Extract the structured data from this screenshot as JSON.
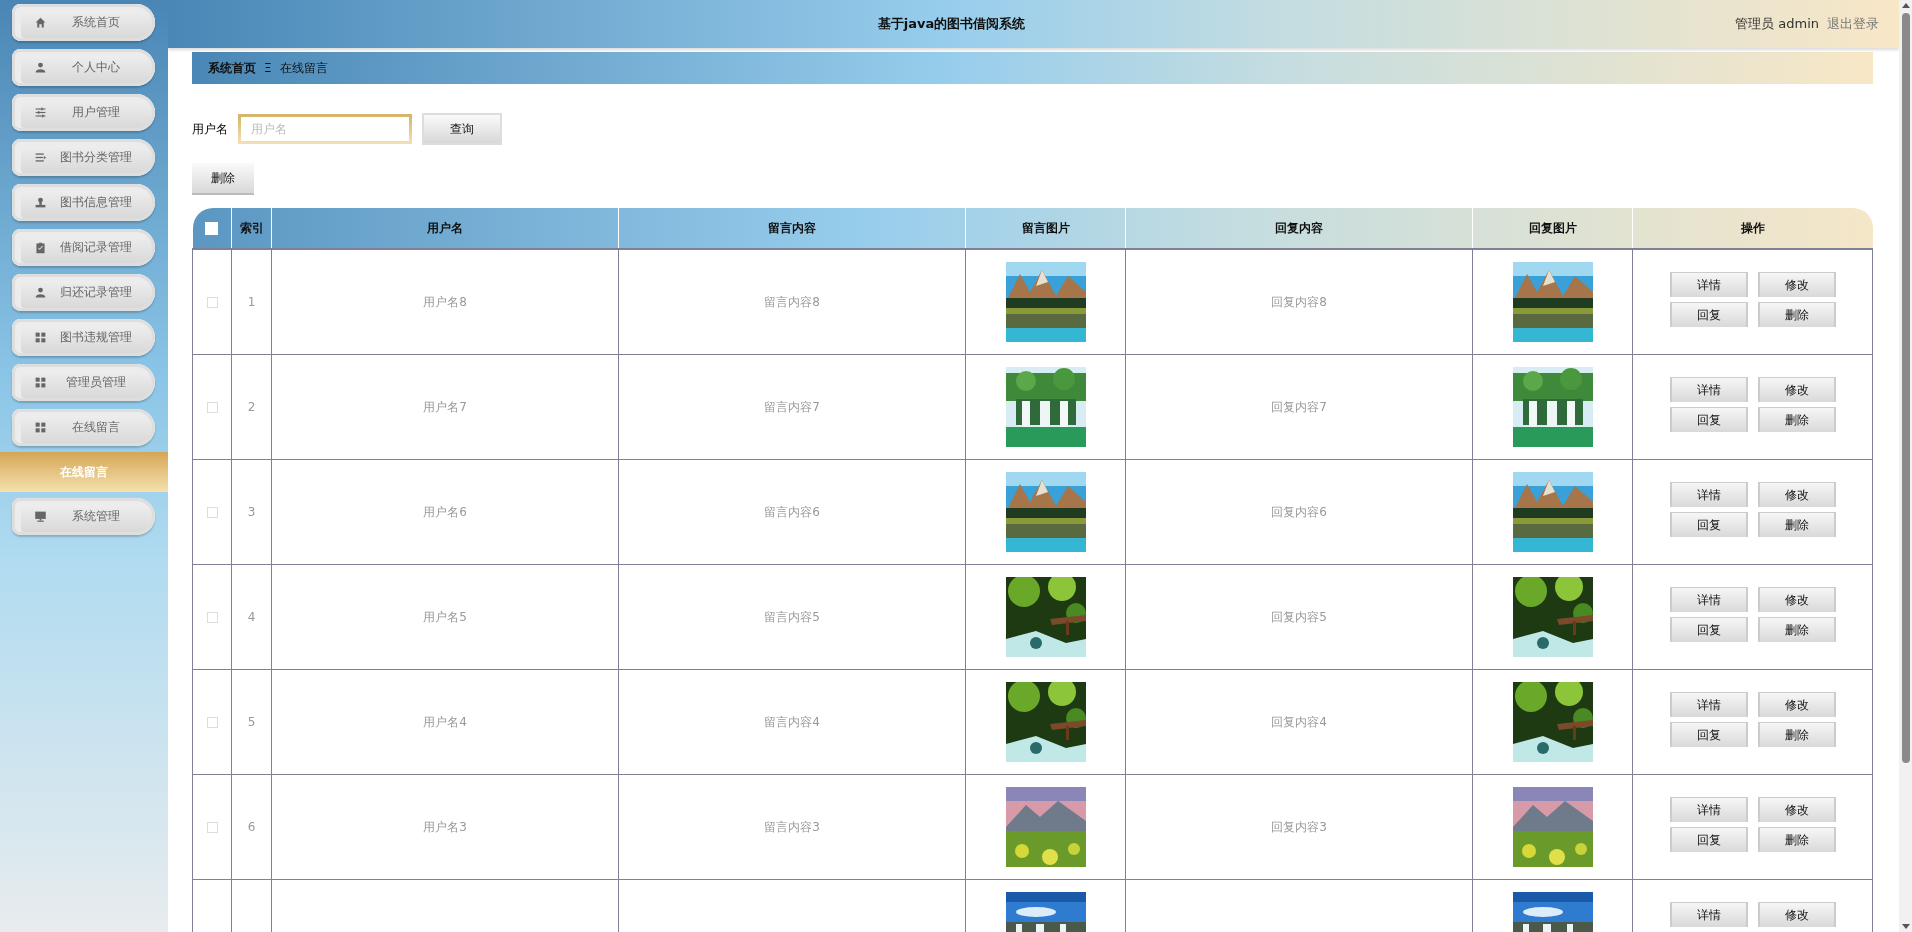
{
  "sidebar": {
    "items": [
      {
        "label": "系统首页"
      },
      {
        "label": "个人中心"
      },
      {
        "label": "用户管理"
      },
      {
        "label": "图书分类管理"
      },
      {
        "label": "图书信息管理"
      },
      {
        "label": "借阅记录管理"
      },
      {
        "label": "归还记录管理"
      },
      {
        "label": "图书违规管理"
      },
      {
        "label": "管理员管理"
      },
      {
        "label": "在线留言",
        "children": [
          {
            "label": "在线留言",
            "selected": true
          }
        ]
      },
      {
        "label": "系统管理"
      }
    ]
  },
  "topbar": {
    "title": "基于java的图书借阅系统",
    "user": "管理员 admin",
    "logout": "退出登录"
  },
  "breadcrumb": {
    "home": "系统首页",
    "separator": "Ξ",
    "current": "在线留言"
  },
  "search": {
    "label": "用户名",
    "placeholder": "用户名",
    "button": "查询"
  },
  "delete_button": "删除",
  "table": {
    "header_checkbox": {
      "checked": false
    },
    "columns": [
      "索引",
      "用户名",
      "留言内容",
      "留言图片",
      "回复内容",
      "回复图片",
      "操作"
    ],
    "rows": [
      {
        "checked": false,
        "index": "1",
        "username": "用户名8",
        "message": "留言内容8",
        "message_image": {
          "kind": "picture"
        },
        "reply": "回复内容8",
        "reply_image": {
          "kind": "picture"
        },
        "actions": [
          "详情",
          "修改",
          "回复",
          "删除"
        ]
      },
      {
        "checked": false,
        "index": "2",
        "username": "用户名7",
        "message": "留言内容7",
        "message_image": {
          "kind": "picture"
        },
        "reply": "回复内容7",
        "reply_image": {
          "kind": "picture"
        },
        "actions": [
          "详情",
          "修改",
          "回复",
          "删除"
        ]
      },
      {
        "checked": false,
        "index": "3",
        "username": "用户名6",
        "message": "留言内容6",
        "message_image": {
          "kind": "picture"
        },
        "reply": "回复内容6",
        "reply_image": {
          "kind": "picture"
        },
        "actions": [
          "详情",
          "修改",
          "回复",
          "删除"
        ]
      },
      {
        "checked": false,
        "index": "4",
        "username": "用户名5",
        "message": "留言内容5",
        "message_image": {
          "kind": "picture"
        },
        "reply": "回复内容5",
        "reply_image": {
          "kind": "picture"
        },
        "actions": [
          "详情",
          "修改",
          "回复",
          "删除"
        ]
      },
      {
        "checked": false,
        "index": "5",
        "username": "用户名4",
        "message": "留言内容4",
        "message_image": {
          "kind": "picture"
        },
        "reply": "回复内容4",
        "reply_image": {
          "kind": "picture"
        },
        "actions": [
          "详情",
          "修改",
          "回复",
          "删除"
        ]
      },
      {
        "checked": false,
        "index": "6",
        "username": "用户名3",
        "message": "留言内容3",
        "message_image": {
          "kind": "picture"
        },
        "reply": "回复内容3",
        "reply_image": {
          "kind": "picture"
        },
        "actions": [
          "详情",
          "修改",
          "回复",
          "删除"
        ]
      },
      {
        "message_image": {
          "kind": "picture"
        },
        "reply_image": {
          "kind": "picture"
        },
        "actions": [
          "详情",
          "修改"
        ]
      }
    ]
  }
}
